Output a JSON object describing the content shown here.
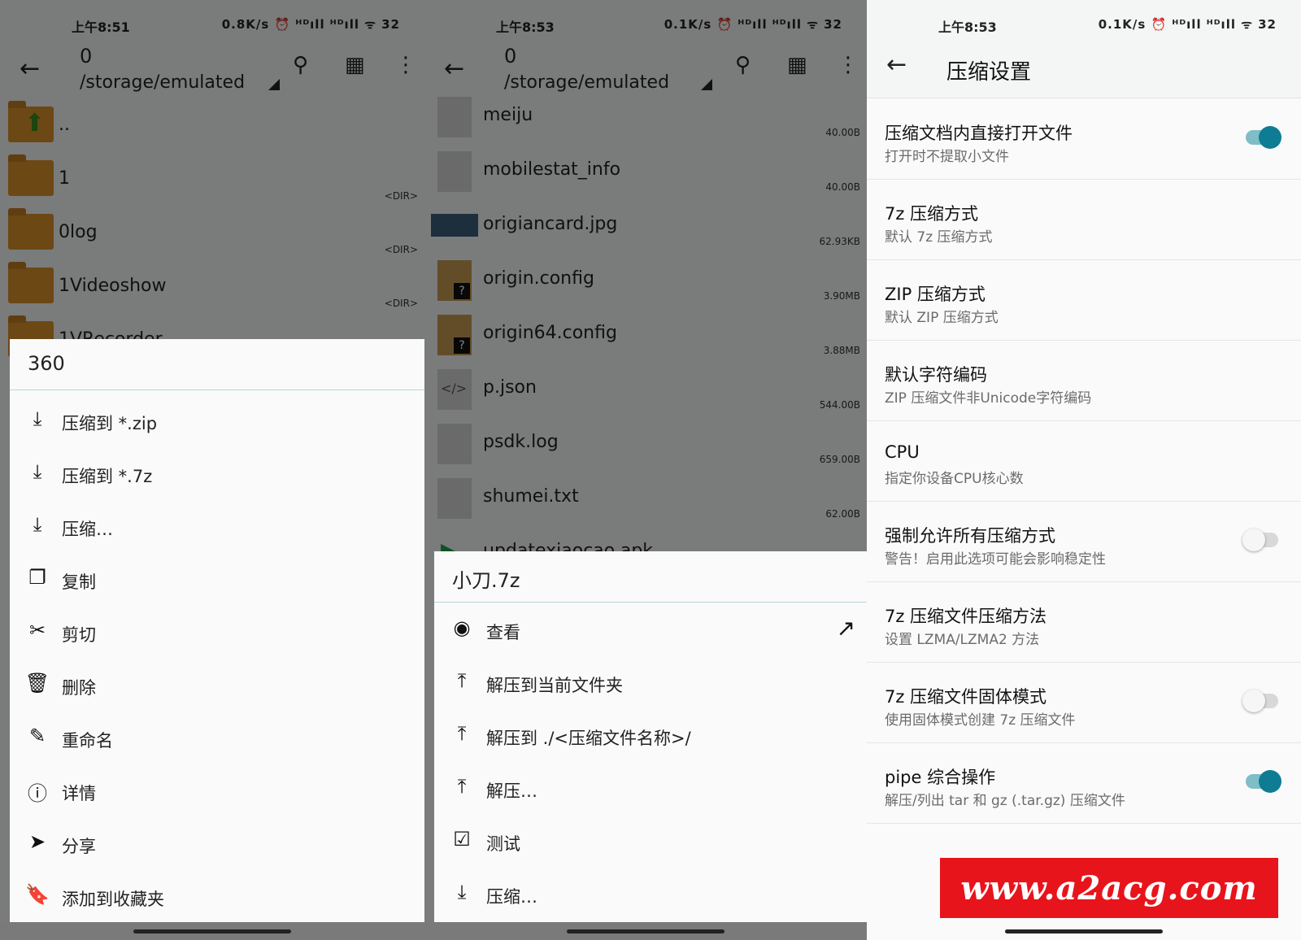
{
  "panel1": {
    "status": {
      "time": "上午8:51",
      "right": "0.8K/s ⏰ ᴴᴰıll ᴴᴰıll ᯤ 32"
    },
    "path_number": "0",
    "path_text": "/storage/emulated",
    "files": [
      {
        "name": "..",
        "size": ""
      },
      {
        "name": "1",
        "size": "<DIR>"
      },
      {
        "name": "0log",
        "size": "<DIR>"
      },
      {
        "name": "1Videoshow",
        "size": "<DIR>"
      },
      {
        "name": "1VRecorder",
        "size": ""
      }
    ],
    "menu_title": "360",
    "menu": [
      {
        "icon": "download-icon",
        "label": "压缩到 *.zip"
      },
      {
        "icon": "download-icon",
        "label": "压缩到 *.7z"
      },
      {
        "icon": "download-icon",
        "label": "压缩…"
      },
      {
        "icon": "copy-icon",
        "label": "复制"
      },
      {
        "icon": "scissors-icon",
        "label": "剪切"
      },
      {
        "icon": "trash-icon",
        "label": "删除"
      },
      {
        "icon": "pencil-icon",
        "label": "重命名"
      },
      {
        "icon": "info-icon",
        "label": "详情"
      },
      {
        "icon": "send-icon",
        "label": "分享"
      },
      {
        "icon": "bookmark-icon",
        "label": "添加到收藏夹"
      }
    ]
  },
  "panel2": {
    "status": {
      "time": "上午8:53",
      "right": "0.1K/s ⏰ ᴴᴰıll ᴴᴰıll ᯤ 32"
    },
    "path_number": "0",
    "path_text": "/storage/emulated",
    "files": [
      {
        "name": "meiju",
        "size": "40.00B"
      },
      {
        "name": "mobilestat_info",
        "size": "40.00B"
      },
      {
        "name": "origiancard.jpg",
        "size": "62.93KB"
      },
      {
        "name": "origin.config",
        "size": "3.90MB"
      },
      {
        "name": "origin64.config",
        "size": "3.88MB"
      },
      {
        "name": "p.json",
        "size": "544.00B"
      },
      {
        "name": "psdk.log",
        "size": "659.00B"
      },
      {
        "name": "shumei.txt",
        "size": "62.00B"
      },
      {
        "name": "updatexiaocao.apk",
        "size": ""
      }
    ],
    "menu_title": "小刀.7z",
    "menu": [
      {
        "icon": "eye-icon",
        "label": "查看"
      },
      {
        "icon": "upload-icon",
        "label": "解压到当前文件夹"
      },
      {
        "icon": "upload-icon",
        "label": "解压到 ./<压缩文件名称>/"
      },
      {
        "icon": "upload-icon",
        "label": "解压…"
      },
      {
        "icon": "checkbox-icon",
        "label": "测试"
      },
      {
        "icon": "download-icon",
        "label": "压缩…"
      }
    ]
  },
  "panel3": {
    "status": {
      "time": "上午8:53",
      "right": "0.1K/s ⏰ ᴴᴰıll ᴴᴰıll ᯤ 32"
    },
    "title": "压缩设置",
    "settings": [
      {
        "title": "压缩文档内直接打开文件",
        "subtitle": "打开时不提取小文件",
        "toggle": "on"
      },
      {
        "title": "7z 压缩方式",
        "subtitle": "默认 7z 压缩方式",
        "toggle": "none"
      },
      {
        "title": "ZIP 压缩方式",
        "subtitle": "默认 ZIP 压缩方式",
        "toggle": "none"
      },
      {
        "title": "默认字符编码",
        "subtitle": "ZIP 压缩文件非Unicode字符编码",
        "toggle": "none"
      },
      {
        "title": "CPU",
        "subtitle": "指定你设备CPU核心数",
        "toggle": "none"
      },
      {
        "title": "强制允许所有压缩方式",
        "subtitle": "警告！启用此选项可能会影响稳定性",
        "toggle": "off"
      },
      {
        "title": "7z 压缩文件压缩方法",
        "subtitle": "设置 LZMA/LZMA2 方法",
        "toggle": "none"
      },
      {
        "title": "7z 压缩文件固体模式",
        "subtitle": "使用固体模式创建 7z 压缩文件",
        "toggle": "off"
      },
      {
        "title": "pipe 综合操作",
        "subtitle": "解压/列出 tar 和 gz (.tar.gz) 压缩文件",
        "toggle": "on"
      }
    ],
    "watermark": "www.a2acg.com"
  },
  "colors": {
    "accent": "#0e7d94",
    "folder": "#d8902a",
    "watermark": "#e8141c"
  }
}
